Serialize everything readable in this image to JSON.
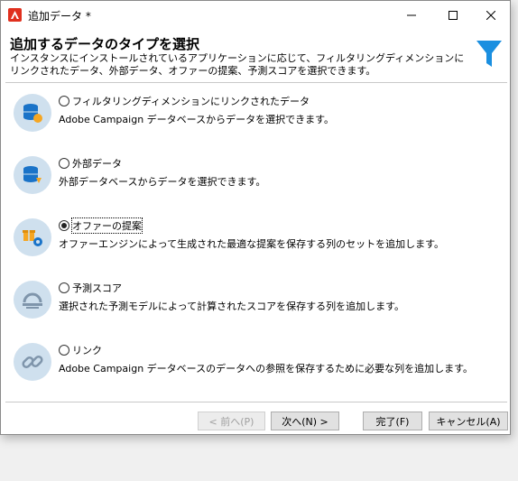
{
  "window": {
    "title": "追加データ *",
    "controls": {
      "minimize": "minimize-icon",
      "maximize": "maximize-icon",
      "close": "close-icon"
    }
  },
  "header": {
    "title": "追加するデータのタイプを選択",
    "description": "インスタンスにインストールされているアプリケーションに応じて、フィルタリングディメンションにリンクされたデータ、外部データ、オファーの提案、予測スコアを選択できます。",
    "icon": "funnel-icon"
  },
  "options": [
    {
      "label": "フィルタリングディメンションにリンクされたデータ",
      "description": "Adobe Campaign データベースからデータを選択できます。",
      "checked": false,
      "icon": "database-user-icon"
    },
    {
      "label": "外部データ",
      "description": "外部データベースからデータを選択できます。",
      "checked": false,
      "icon": "external-database-icon"
    },
    {
      "label": "オファーの提案",
      "description": "オファーエンジンによって生成された最適な提案を保存する列のセットを追加します。",
      "checked": true,
      "icon": "offer-icon"
    },
    {
      "label": "予測スコア",
      "description": "選択された予測モデルによって計算されたスコアを保存する列を追加します。",
      "checked": false,
      "icon": "predictive-score-icon"
    },
    {
      "label": "リンク",
      "description": "Adobe Campaign データベースのデータへの参照を保存するために必要な列を追加します。",
      "checked": false,
      "icon": "link-icon"
    }
  ],
  "buttons": {
    "prev": "< 前へ(P)",
    "next": "次へ(N) >",
    "finish": "完了(F)",
    "cancel": "キャンセル(A)"
  },
  "colors": {
    "accent": "#1a8fe0",
    "icon_bg": "#cfe0ee",
    "app_red": "#e0301e"
  }
}
